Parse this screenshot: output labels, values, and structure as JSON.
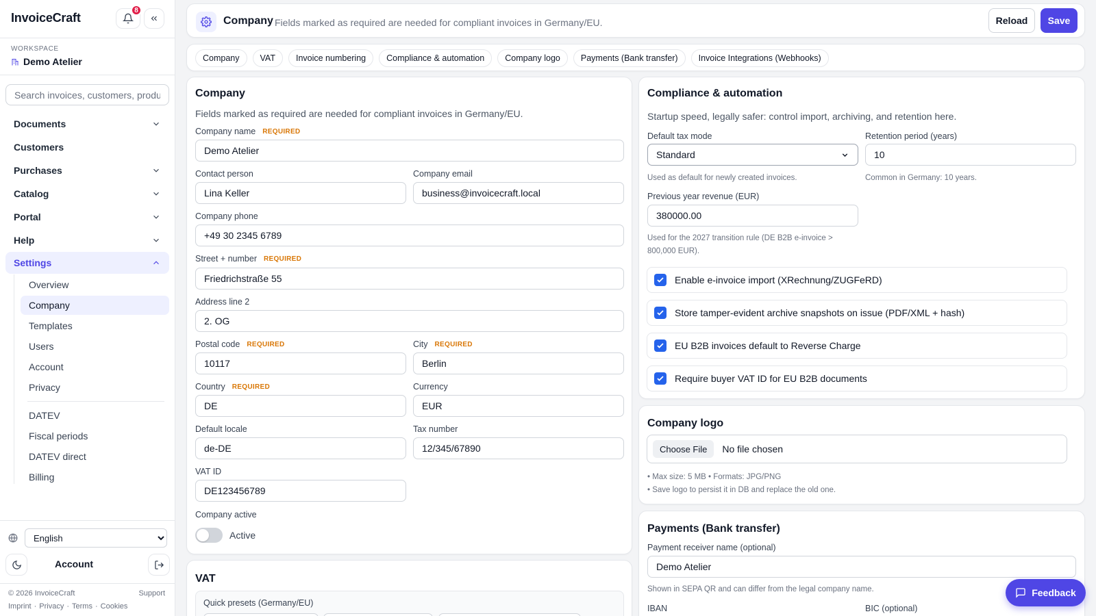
{
  "app": {
    "brand": "InvoiceCraft",
    "notifications_count": "8"
  },
  "workspace": {
    "label": "WORKSPACE",
    "name": "Demo Atelier"
  },
  "search": {
    "placeholder": "Search invoices, customers, products…"
  },
  "nav": {
    "items": [
      {
        "label": "Documents",
        "expandable": true
      },
      {
        "label": "Customers",
        "expandable": false
      },
      {
        "label": "Purchases",
        "expandable": true
      },
      {
        "label": "Catalog",
        "expandable": true
      },
      {
        "label": "Portal",
        "expandable": true
      },
      {
        "label": "Help",
        "expandable": true
      },
      {
        "label": "Settings",
        "expandable": true,
        "expanded": true
      }
    ],
    "settings_sub": [
      "Overview",
      "Company",
      "Templates",
      "Users",
      "Account",
      "Privacy",
      "DATEV",
      "Fiscal periods",
      "DATEV direct",
      "Billing"
    ],
    "active_sub": "Company"
  },
  "sidebar_footer": {
    "language": "English",
    "account": "Account",
    "copyright": "© 2026 InvoiceCraft",
    "support": "Support",
    "links": [
      "Imprint",
      "Privacy",
      "Terms",
      "Cookies"
    ]
  },
  "header": {
    "title": "Company",
    "description": "Fields marked as required are needed for compliant invoices in Germany/EU.",
    "reload": "Reload",
    "save": "Save"
  },
  "tabs": [
    "Company",
    "VAT",
    "Invoice numbering",
    "Compliance & automation",
    "Company logo",
    "Payments (Bank transfer)",
    "Invoice Integrations (Webhooks)"
  ],
  "company_form": {
    "title": "Company",
    "description": "Fields marked as required are needed for compliant invoices in Germany/EU.",
    "required_tag": "REQUIRED",
    "fields": {
      "company_name": {
        "label": "Company name",
        "value": "Demo Atelier"
      },
      "contact_person": {
        "label": "Contact person",
        "value": "Lina Keller"
      },
      "company_email": {
        "label": "Company email",
        "value": "business@invoicecraft.local"
      },
      "company_phone": {
        "label": "Company phone",
        "value": "+49 30 2345 6789"
      },
      "street": {
        "label": "Street + number",
        "value": "Friedrichstraße 55"
      },
      "address2": {
        "label": "Address line 2",
        "value": "2. OG"
      },
      "postal_code": {
        "label": "Postal code",
        "value": "10117"
      },
      "city": {
        "label": "City",
        "value": "Berlin"
      },
      "country": {
        "label": "Country",
        "value": "DE"
      },
      "currency": {
        "label": "Currency",
        "value": "EUR"
      },
      "default_locale": {
        "label": "Default locale",
        "value": "de-DE"
      },
      "tax_number": {
        "label": "Tax number",
        "value": "12/345/67890"
      },
      "vat_id": {
        "label": "VAT ID",
        "value": "DE123456789"
      }
    },
    "active": {
      "label": "Company active",
      "toggle_label": "Active",
      "on": false
    }
  },
  "vat_section": {
    "title": "VAT",
    "presets_label": "Quick presets (Germany/EU)"
  },
  "compliance": {
    "title": "Compliance & automation",
    "description": "Startup speed, legally safer: control import, archiving, and retention here.",
    "tax_mode": {
      "label": "Default tax mode",
      "value": "Standard",
      "help": "Used as default for newly created invoices."
    },
    "retention": {
      "label": "Retention period (years)",
      "value": "10",
      "help": "Common in Germany: 10 years."
    },
    "prev_revenue": {
      "label": "Previous year revenue (EUR)",
      "value": "380000.00",
      "help_line1": "Used for the 2027 transition rule (DE B2B e-invoice >",
      "help_line2": "800,000 EUR)."
    },
    "checks": [
      "Enable e-invoice import (XRechnung/ZUGFeRD)",
      "Store tamper-evident archive snapshots on issue (PDF/XML + hash)",
      "EU B2B invoices default to Reverse Charge",
      "Require buyer VAT ID for EU B2B documents"
    ]
  },
  "logo": {
    "title": "Company logo",
    "choose": "Choose File",
    "no_file": "No file chosen",
    "hint1": "• Max size: 5 MB • Formats: JPG/PNG",
    "hint2": "• Save logo to persist it in DB and replace the old one."
  },
  "payments": {
    "title": "Payments (Bank transfer)",
    "receiver_label": "Payment receiver name (optional)",
    "receiver_value": "Demo Atelier",
    "receiver_help": "Shown in SEPA QR and can differ from the legal company name.",
    "iban_label": "IBAN",
    "bic_label": "BIC (optional)"
  },
  "feedback": "Feedback",
  "colors": {
    "accent": "#4f46e5",
    "required": "#d97706",
    "checkbox": "#2563eb"
  }
}
